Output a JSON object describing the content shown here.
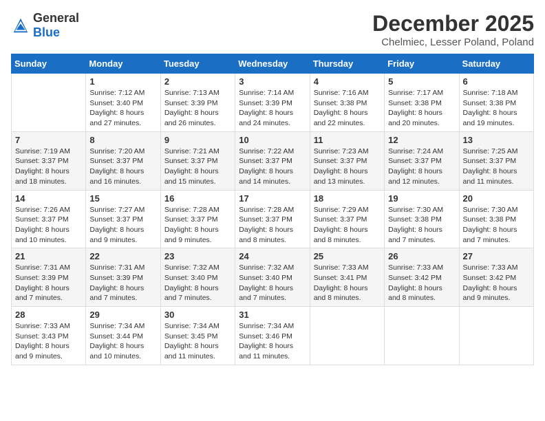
{
  "header": {
    "logo_general": "General",
    "logo_blue": "Blue",
    "month": "December 2025",
    "location": "Chelmiec, Lesser Poland, Poland"
  },
  "days_of_week": [
    "Sunday",
    "Monday",
    "Tuesday",
    "Wednesday",
    "Thursday",
    "Friday",
    "Saturday"
  ],
  "weeks": [
    [
      {
        "day": "",
        "info": ""
      },
      {
        "day": "1",
        "info": "Sunrise: 7:12 AM\nSunset: 3:40 PM\nDaylight: 8 hours and 27 minutes."
      },
      {
        "day": "2",
        "info": "Sunrise: 7:13 AM\nSunset: 3:39 PM\nDaylight: 8 hours and 26 minutes."
      },
      {
        "day": "3",
        "info": "Sunrise: 7:14 AM\nSunset: 3:39 PM\nDaylight: 8 hours and 24 minutes."
      },
      {
        "day": "4",
        "info": "Sunrise: 7:16 AM\nSunset: 3:38 PM\nDaylight: 8 hours and 22 minutes."
      },
      {
        "day": "5",
        "info": "Sunrise: 7:17 AM\nSunset: 3:38 PM\nDaylight: 8 hours and 20 minutes."
      },
      {
        "day": "6",
        "info": "Sunrise: 7:18 AM\nSunset: 3:38 PM\nDaylight: 8 hours and 19 minutes."
      }
    ],
    [
      {
        "day": "7",
        "info": "Sunrise: 7:19 AM\nSunset: 3:37 PM\nDaylight: 8 hours and 18 minutes."
      },
      {
        "day": "8",
        "info": "Sunrise: 7:20 AM\nSunset: 3:37 PM\nDaylight: 8 hours and 16 minutes."
      },
      {
        "day": "9",
        "info": "Sunrise: 7:21 AM\nSunset: 3:37 PM\nDaylight: 8 hours and 15 minutes."
      },
      {
        "day": "10",
        "info": "Sunrise: 7:22 AM\nSunset: 3:37 PM\nDaylight: 8 hours and 14 minutes."
      },
      {
        "day": "11",
        "info": "Sunrise: 7:23 AM\nSunset: 3:37 PM\nDaylight: 8 hours and 13 minutes."
      },
      {
        "day": "12",
        "info": "Sunrise: 7:24 AM\nSunset: 3:37 PM\nDaylight: 8 hours and 12 minutes."
      },
      {
        "day": "13",
        "info": "Sunrise: 7:25 AM\nSunset: 3:37 PM\nDaylight: 8 hours and 11 minutes."
      }
    ],
    [
      {
        "day": "14",
        "info": "Sunrise: 7:26 AM\nSunset: 3:37 PM\nDaylight: 8 hours and 10 minutes."
      },
      {
        "day": "15",
        "info": "Sunrise: 7:27 AM\nSunset: 3:37 PM\nDaylight: 8 hours and 9 minutes."
      },
      {
        "day": "16",
        "info": "Sunrise: 7:28 AM\nSunset: 3:37 PM\nDaylight: 8 hours and 9 minutes."
      },
      {
        "day": "17",
        "info": "Sunrise: 7:28 AM\nSunset: 3:37 PM\nDaylight: 8 hours and 8 minutes."
      },
      {
        "day": "18",
        "info": "Sunrise: 7:29 AM\nSunset: 3:37 PM\nDaylight: 8 hours and 8 minutes."
      },
      {
        "day": "19",
        "info": "Sunrise: 7:30 AM\nSunset: 3:38 PM\nDaylight: 8 hours and 7 minutes."
      },
      {
        "day": "20",
        "info": "Sunrise: 7:30 AM\nSunset: 3:38 PM\nDaylight: 8 hours and 7 minutes."
      }
    ],
    [
      {
        "day": "21",
        "info": "Sunrise: 7:31 AM\nSunset: 3:39 PM\nDaylight: 8 hours and 7 minutes."
      },
      {
        "day": "22",
        "info": "Sunrise: 7:31 AM\nSunset: 3:39 PM\nDaylight: 8 hours and 7 minutes."
      },
      {
        "day": "23",
        "info": "Sunrise: 7:32 AM\nSunset: 3:40 PM\nDaylight: 8 hours and 7 minutes."
      },
      {
        "day": "24",
        "info": "Sunrise: 7:32 AM\nSunset: 3:40 PM\nDaylight: 8 hours and 7 minutes."
      },
      {
        "day": "25",
        "info": "Sunrise: 7:33 AM\nSunset: 3:41 PM\nDaylight: 8 hours and 8 minutes."
      },
      {
        "day": "26",
        "info": "Sunrise: 7:33 AM\nSunset: 3:42 PM\nDaylight: 8 hours and 8 minutes."
      },
      {
        "day": "27",
        "info": "Sunrise: 7:33 AM\nSunset: 3:42 PM\nDaylight: 8 hours and 9 minutes."
      }
    ],
    [
      {
        "day": "28",
        "info": "Sunrise: 7:33 AM\nSunset: 3:43 PM\nDaylight: 8 hours and 9 minutes."
      },
      {
        "day": "29",
        "info": "Sunrise: 7:34 AM\nSunset: 3:44 PM\nDaylight: 8 hours and 10 minutes."
      },
      {
        "day": "30",
        "info": "Sunrise: 7:34 AM\nSunset: 3:45 PM\nDaylight: 8 hours and 11 minutes."
      },
      {
        "day": "31",
        "info": "Sunrise: 7:34 AM\nSunset: 3:46 PM\nDaylight: 8 hours and 11 minutes."
      },
      {
        "day": "",
        "info": ""
      },
      {
        "day": "",
        "info": ""
      },
      {
        "day": "",
        "info": ""
      }
    ]
  ]
}
